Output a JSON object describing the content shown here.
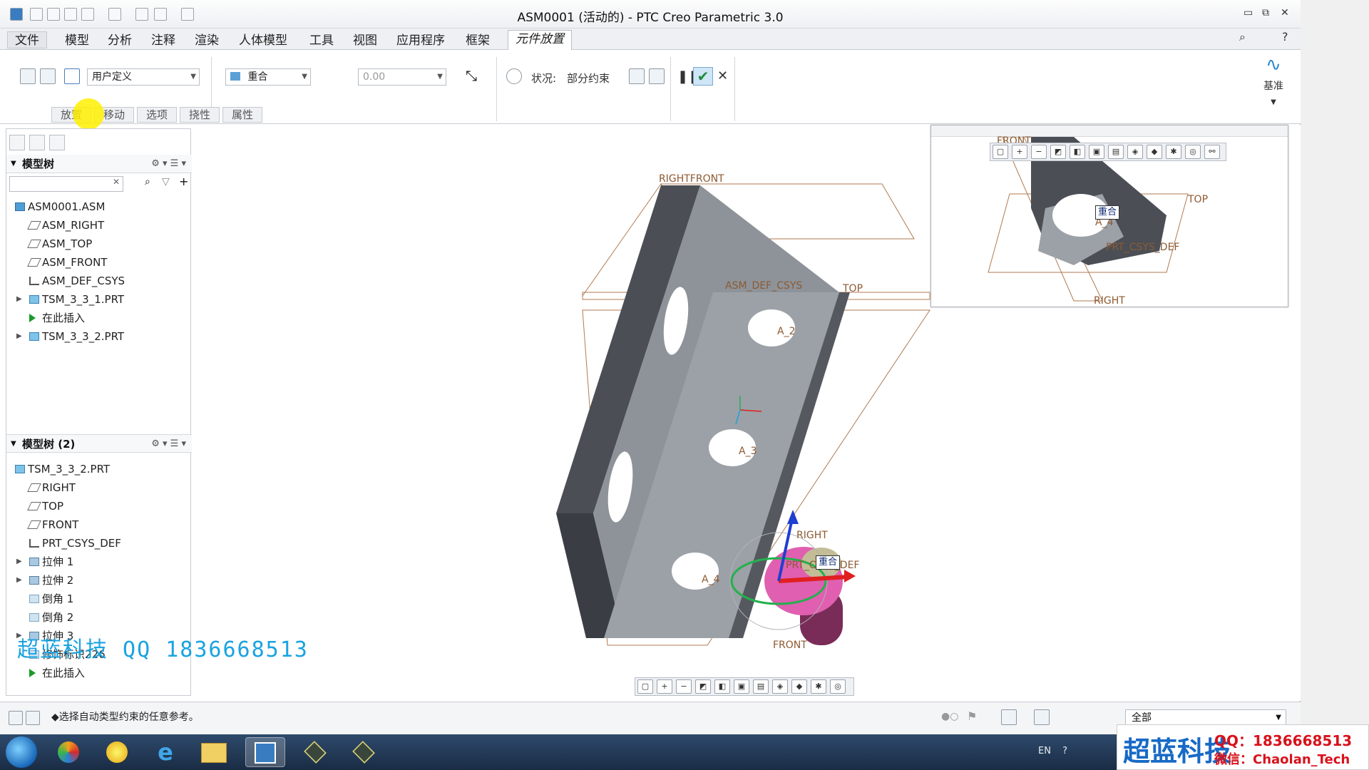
{
  "window": {
    "title": "ASM0001 (活动的) - PTC Creo Parametric 3.0",
    "minimize_glyph": "▭",
    "restore_glyph": "⧉",
    "close_glyph": "✕"
  },
  "menus": [
    "文件",
    "模型",
    "分析",
    "注释",
    "渲染",
    "人体模型",
    "工具",
    "视图",
    "应用程序",
    "框架",
    "元件放置"
  ],
  "ribbon": {
    "constraint_set": "用户定义",
    "constraint_type": "重合",
    "offset_value": "0.00",
    "status_label": "状况:",
    "status_value": "部分约束",
    "datum_label": "基准",
    "subtabs": [
      "放置",
      "移动",
      "选项",
      "挠性",
      "属性"
    ]
  },
  "model_tree": {
    "header": "模型树",
    "items": [
      "ASM0001.ASM",
      "ASM_RIGHT",
      "ASM_TOP",
      "ASM_FRONT",
      "ASM_DEF_CSYS",
      "TSM_3_3_1.PRT",
      "在此插入",
      "TSM_3_3_2.PRT"
    ]
  },
  "model_tree_2": {
    "header": "模型树 (2)",
    "items": [
      "TSM_3_3_2.PRT",
      "RIGHT",
      "TOP",
      "FRONT",
      "PRT_CSYS_DEF",
      "拉伸 1",
      "拉伸 2",
      "倒角 1",
      "倒角 2",
      "拉伸 3",
      "修饰标识226",
      "在此插入"
    ]
  },
  "viewport": {
    "labels": {
      "front_top": "RIGHTFRONT",
      "csys": "ASM_DEF_CSYS",
      "top": "TOP",
      "a2": "A_2",
      "a3": "A_3",
      "a4": "A_4",
      "right_small": "RIGHT",
      "coincident": "重合",
      "front_small": "FRONT",
      "prt_csys": "PRT_CSYS_DEF"
    },
    "inset_labels": {
      "front": "FRONT",
      "top": "TOP",
      "coincident": "重合",
      "a4": "A_4",
      "prt_csys": "PRT_CSYS_DEF",
      "right": "RIGHT"
    }
  },
  "prompt": "◆选择自动类型约束的任意参考。",
  "filter": "全部",
  "watermark": "超蓝科技   QQ 1836668513",
  "brand": {
    "name": "超蓝科技",
    "qq": "QQ：1836668513",
    "wechat": "微信：Chaolan_Tech"
  },
  "tray": {
    "lang": "EN"
  }
}
